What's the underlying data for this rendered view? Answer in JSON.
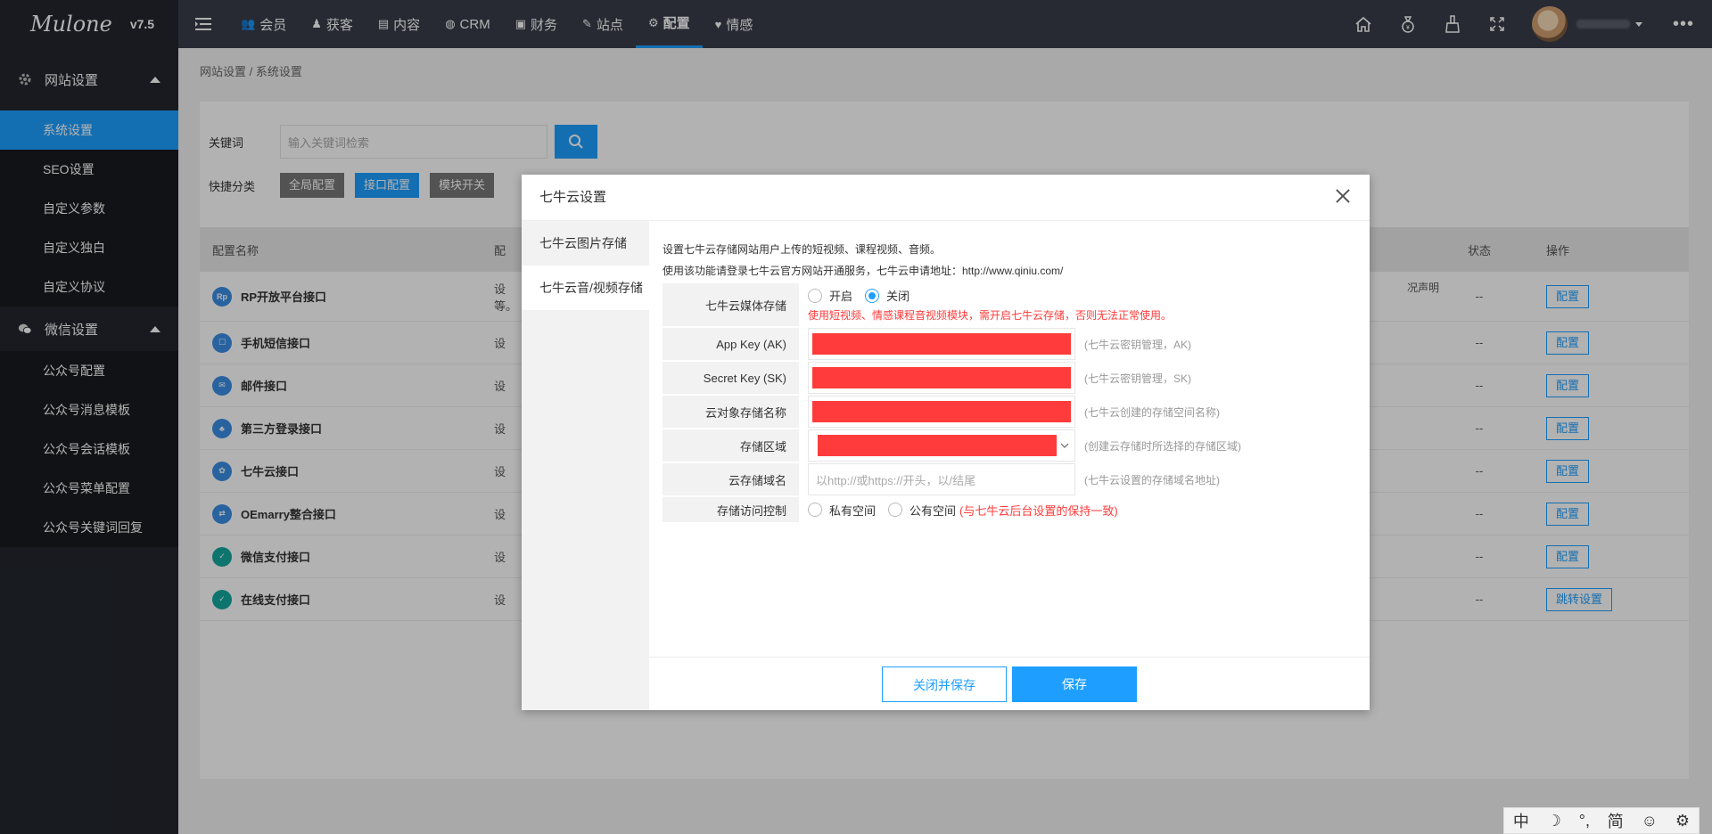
{
  "app": {
    "brand": "Mulone",
    "version": "v7.5"
  },
  "topnav": {
    "tabs": [
      {
        "icon": "user-group-icon",
        "glyph": "👥",
        "label": "会员"
      },
      {
        "icon": "person-icon",
        "glyph": "♟",
        "label": "获客"
      },
      {
        "icon": "document-icon",
        "glyph": "▤",
        "label": "内容"
      },
      {
        "icon": "crm-icon",
        "glyph": "◍",
        "label": "CRM"
      },
      {
        "icon": "finance-icon",
        "glyph": "▣",
        "label": "财务"
      },
      {
        "icon": "site-icon",
        "glyph": "✎",
        "label": "站点"
      },
      {
        "icon": "gear-icon",
        "glyph": "⚙",
        "label": "配置"
      },
      {
        "icon": "heart-icon",
        "glyph": "♥",
        "label": "情感"
      }
    ],
    "active_tab": "配置",
    "right_icons": [
      "home-icon",
      "money-bag-icon",
      "broom-icon",
      "fullscreen-icon"
    ],
    "more": "•••"
  },
  "sidebar": {
    "groups": [
      {
        "label": "网站设置",
        "icon": "gear-icon",
        "items": [
          "系统设置",
          "SEO设置",
          "自定义参数",
          "自定义独白",
          "自定义协议"
        ]
      },
      {
        "label": "微信设置",
        "icon": "wechat-icon",
        "items": [
          "公众号配置",
          "公众号消息模板",
          "公众号会话模板",
          "公众号菜单配置",
          "公众号关键词回复"
        ]
      }
    ],
    "active_item": "系统设置"
  },
  "breadcrumb": "网站设置 / 系统设置",
  "filters": {
    "keyword_label": "关键词",
    "keyword_placeholder": "输入关键词检索",
    "quick_label": "快捷分类",
    "quick_buttons": [
      "全局配置",
      "接口配置",
      "模块开关"
    ],
    "active_quick": "接口配置"
  },
  "table": {
    "headers": [
      "配置名称",
      "配",
      "状态",
      "操作"
    ],
    "rows": [
      {
        "name": "RP开放平台接口",
        "desc": "设",
        "status": "--",
        "action": "配置",
        "icon": "Rp",
        "color": "#3a8ee6"
      },
      {
        "name": "手机短信接口",
        "desc": "设",
        "status": "--",
        "action": "配置",
        "icon": "☐",
        "color": "#3a8ee6"
      },
      {
        "name": "邮件接口",
        "desc": "设",
        "status": "--",
        "action": "配置",
        "icon": "✉",
        "color": "#3a8ee6"
      },
      {
        "name": "第三方登录接口",
        "desc": "设",
        "status": "--",
        "action": "配置",
        "icon": "♣",
        "color": "#3a8ee6"
      },
      {
        "name": "七牛云接口",
        "desc": "设",
        "status": "--",
        "action": "配置",
        "icon": "✿",
        "color": "#3a8ee6"
      },
      {
        "name": "OEmarry整合接口",
        "desc": "设",
        "status": "--",
        "action": "配置",
        "icon": "⇄",
        "color": "#3a8ee6"
      },
      {
        "name": "微信支付接口",
        "desc": "设",
        "status": "--",
        "action": "配置",
        "icon": "✓",
        "color": "#13a89e"
      },
      {
        "name": "在线支付接口",
        "desc": "设",
        "status": "--",
        "action": "跳转设置",
        "icon": "✓",
        "color": "#13a89e"
      }
    ],
    "row1_desc_extra": "等。",
    "row1_desc_right": "况声明"
  },
  "modal": {
    "title": "七牛云设置",
    "tabs": [
      "七牛云图片存储",
      "七牛云音/视频存储"
    ],
    "active_tab": "七牛云音/视频存储",
    "intro_line1": "设置七牛云存储网站用户上传的短视频、课程视频、音频。",
    "intro_line2": "使用该功能请登录七牛云官方网站开通服务，七牛云申请地址：http://www.qiniu.com/",
    "fields": {
      "media_storage": {
        "label": "七牛云媒体存储",
        "options": [
          "开启",
          "关闭"
        ],
        "selected": "关闭",
        "warning": "使用短视频、情感课程音视频模块，需开启七牛云存储，否则无法正常使用。"
      },
      "app_key": {
        "label": "App Key (AK)",
        "hint": "(七牛云密钥管理，AK)"
      },
      "secret_key": {
        "label": "Secret Key (SK)",
        "hint": "(七牛云密钥管理，SK)"
      },
      "bucket": {
        "label": "云对象存储名称",
        "hint": "(七牛云创建的存储空间名称)"
      },
      "region": {
        "label": "存储区域",
        "hint": "(创建云存储时所选择的存储区域)"
      },
      "domain": {
        "label": "云存储域名",
        "placeholder": "以http://或https://开头，以/结尾",
        "hint": "(七牛云设置的存储域名地址)"
      },
      "access": {
        "label": "存储访问控制",
        "options": [
          "私有空间",
          "公有空间"
        ],
        "note": "(与七牛云后台设置的保持一致)"
      }
    },
    "buttons": {
      "close_save": "关闭并保存",
      "save": "保存"
    }
  },
  "ime": {
    "items": [
      "中",
      "☽",
      "°,",
      "简",
      "☺",
      "⚙"
    ]
  }
}
